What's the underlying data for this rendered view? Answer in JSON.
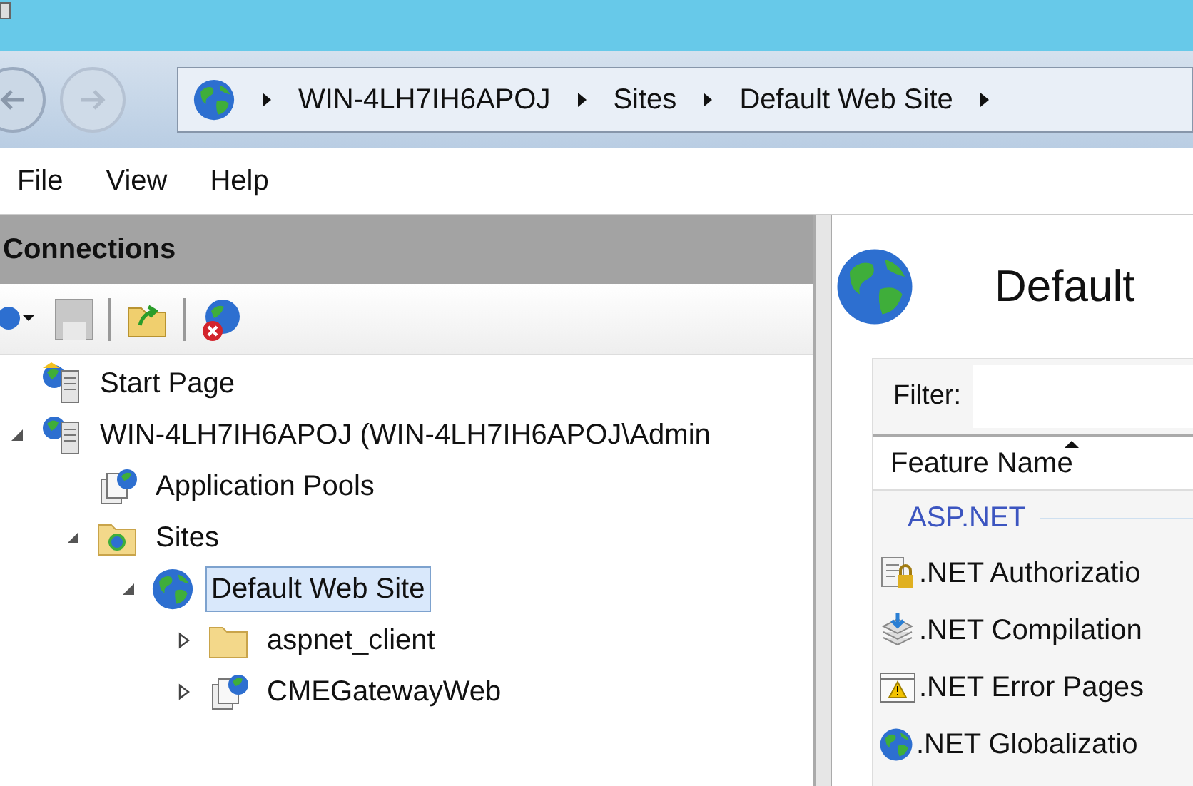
{
  "breadcrumb": [
    "WIN-4LH7IH6APOJ",
    "Sites",
    "Default Web Site"
  ],
  "menu": [
    "File",
    "View",
    "Help"
  ],
  "connections": {
    "title": "Connections",
    "tree": [
      {
        "label": "Start Page",
        "kind": "start",
        "selected": false
      },
      {
        "label": "WIN-4LH7IH6APOJ (WIN-4LH7IH6APOJ\\Admin",
        "kind": "server",
        "expanded": true,
        "selected": false,
        "children": [
          {
            "label": "Application Pools",
            "kind": "pools",
            "selected": false
          },
          {
            "label": "Sites",
            "kind": "sites",
            "expanded": true,
            "selected": false,
            "children": [
              {
                "label": "Default Web Site",
                "kind": "site",
                "expanded": true,
                "selected": true,
                "children": [
                  {
                    "label": "aspnet_client",
                    "kind": "folder",
                    "expanded": false,
                    "selected": false
                  },
                  {
                    "label": "CMEGatewayWeb",
                    "kind": "app",
                    "expanded": false,
                    "selected": false
                  }
                ]
              }
            ]
          }
        ]
      }
    ]
  },
  "content": {
    "title": "Default",
    "filter_label": "Filter:",
    "column": "Feature Name",
    "group": "ASP.NET",
    "features": [
      {
        "label": ".NET Authorizatio",
        "kind": "auth"
      },
      {
        "label": ".NET Compilation",
        "kind": "compile"
      },
      {
        "label": ".NET Error Pages",
        "kind": "error"
      },
      {
        "label": ".NET Globalizatio",
        "kind": "globe"
      }
    ]
  }
}
